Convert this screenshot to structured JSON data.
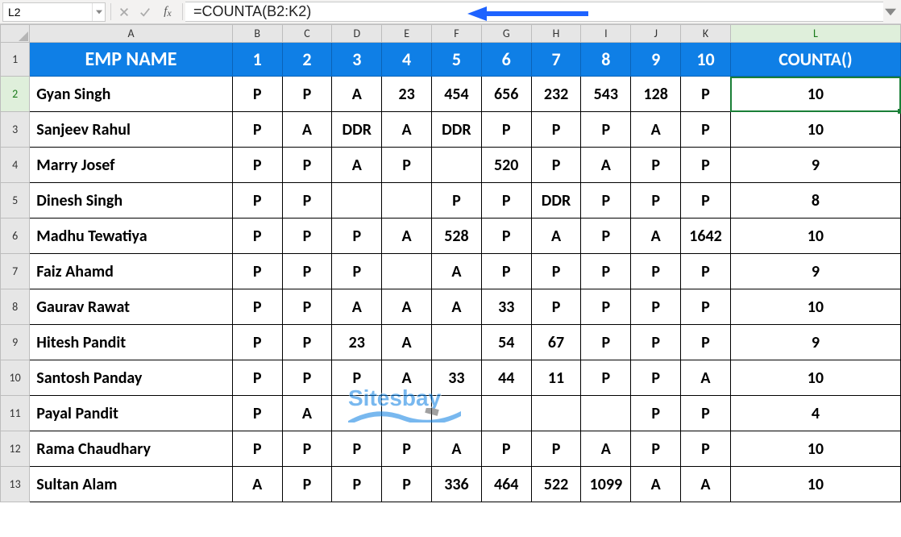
{
  "name_box": "L2",
  "formula": "=COUNTA(B2:K2)",
  "cols": [
    "A",
    "B",
    "C",
    "D",
    "E",
    "F",
    "G",
    "H",
    "I",
    "J",
    "K",
    "L"
  ],
  "active_col": "L",
  "active_row": 2,
  "header_first": "EMP NAME",
  "header_nums": [
    "1",
    "2",
    "3",
    "4",
    "5",
    "6",
    "7",
    "8",
    "9",
    "10"
  ],
  "header_last": "COUNTA()",
  "rows": [
    {
      "n": 2,
      "name": "Gyan Singh",
      "c": [
        "P",
        "P",
        "A",
        "23",
        "454",
        "656",
        "232",
        "543",
        "128",
        "P"
      ],
      "r": "10"
    },
    {
      "n": 3,
      "name": "Sanjeev Rahul",
      "c": [
        "P",
        "A",
        "DDR",
        "A",
        "DDR",
        "P",
        "P",
        "P",
        "A",
        "P"
      ],
      "r": "10"
    },
    {
      "n": 4,
      "name": "Marry Josef",
      "c": [
        "P",
        "P",
        "A",
        "P",
        "",
        "520",
        "P",
        "A",
        "P",
        "P"
      ],
      "r": "9"
    },
    {
      "n": 5,
      "name": "Dinesh Singh",
      "c": [
        "P",
        "P",
        "",
        "",
        "P",
        "P",
        "DDR",
        "P",
        "P",
        "P"
      ],
      "r": "8"
    },
    {
      "n": 6,
      "name": "Madhu Tewatiya",
      "c": [
        "P",
        "P",
        "P",
        "A",
        "528",
        "P",
        "A",
        "P",
        "A",
        "1642"
      ],
      "r": "10"
    },
    {
      "n": 7,
      "name": "Faiz Ahamd",
      "c": [
        "P",
        "P",
        "P",
        "",
        "A",
        "P",
        "P",
        "P",
        "P",
        "P"
      ],
      "r": "9"
    },
    {
      "n": 8,
      "name": "Gaurav Rawat",
      "c": [
        "P",
        "P",
        "A",
        "A",
        "A",
        "33",
        "P",
        "P",
        "P",
        "P"
      ],
      "r": "10"
    },
    {
      "n": 9,
      "name": "Hitesh Pandit",
      "c": [
        "P",
        "P",
        "23",
        "A",
        "",
        "54",
        "67",
        "P",
        "P",
        "P"
      ],
      "r": "9"
    },
    {
      "n": 10,
      "name": "Santosh Panday",
      "c": [
        "P",
        "P",
        "P",
        "A",
        "33",
        "44",
        "11",
        "P",
        "P",
        "A"
      ],
      "r": "10"
    },
    {
      "n": 11,
      "name": "Payal Pandit",
      "c": [
        "P",
        "A",
        "",
        "",
        "",
        "",
        "",
        "",
        "P",
        "P"
      ],
      "r": "4"
    },
    {
      "n": 12,
      "name": "Rama Chaudhary",
      "c": [
        "P",
        "P",
        "P",
        "P",
        "A",
        "P",
        "P",
        "A",
        "P",
        "P"
      ],
      "r": "10"
    },
    {
      "n": 13,
      "name": "Sultan Alam",
      "c": [
        "A",
        "P",
        "P",
        "P",
        "336",
        "464",
        "522",
        "1099",
        "A",
        "A"
      ],
      "r": "10"
    }
  ],
  "watermark_text": "Sitesbay",
  "chart_data": {
    "type": "table",
    "title": "COUNTA demo — Excel sheet",
    "formula_cell": "L2",
    "formula": "=COUNTA(B2:K2)",
    "columns": [
      "EMP NAME",
      "1",
      "2",
      "3",
      "4",
      "5",
      "6",
      "7",
      "8",
      "9",
      "10",
      "COUNTA()"
    ],
    "records": [
      [
        "Gyan Singh",
        "P",
        "P",
        "A",
        "23",
        "454",
        "656",
        "232",
        "543",
        "128",
        "P",
        "10"
      ],
      [
        "Sanjeev Rahul",
        "P",
        "A",
        "DDR",
        "A",
        "DDR",
        "P",
        "P",
        "P",
        "A",
        "P",
        "10"
      ],
      [
        "Marry Josef",
        "P",
        "P",
        "A",
        "P",
        "",
        "520",
        "P",
        "A",
        "P",
        "P",
        "9"
      ],
      [
        "Dinesh Singh",
        "P",
        "P",
        "",
        "",
        "P",
        "P",
        "DDR",
        "P",
        "P",
        "P",
        "8"
      ],
      [
        "Madhu Tewatiya",
        "P",
        "P",
        "P",
        "A",
        "528",
        "P",
        "A",
        "P",
        "A",
        "1642",
        "10"
      ],
      [
        "Faiz Ahamd",
        "P",
        "P",
        "P",
        "",
        "A",
        "P",
        "P",
        "P",
        "P",
        "P",
        "9"
      ],
      [
        "Gaurav Rawat",
        "P",
        "P",
        "A",
        "A",
        "A",
        "33",
        "P",
        "P",
        "P",
        "P",
        "10"
      ],
      [
        "Hitesh Pandit",
        "P",
        "P",
        "23",
        "A",
        "",
        "54",
        "67",
        "P",
        "P",
        "P",
        "9"
      ],
      [
        "Santosh Panday",
        "P",
        "P",
        "P",
        "A",
        "33",
        "44",
        "11",
        "P",
        "P",
        "A",
        "10"
      ],
      [
        "Payal Pandit",
        "P",
        "A",
        "",
        "",
        "",
        "",
        "",
        "",
        "P",
        "P",
        "4"
      ],
      [
        "Rama Chaudhary",
        "P",
        "P",
        "P",
        "P",
        "A",
        "P",
        "P",
        "A",
        "P",
        "P",
        "10"
      ],
      [
        "Sultan Alam",
        "A",
        "P",
        "P",
        "P",
        "336",
        "464",
        "522",
        "1099",
        "A",
        "A",
        "10"
      ]
    ]
  }
}
